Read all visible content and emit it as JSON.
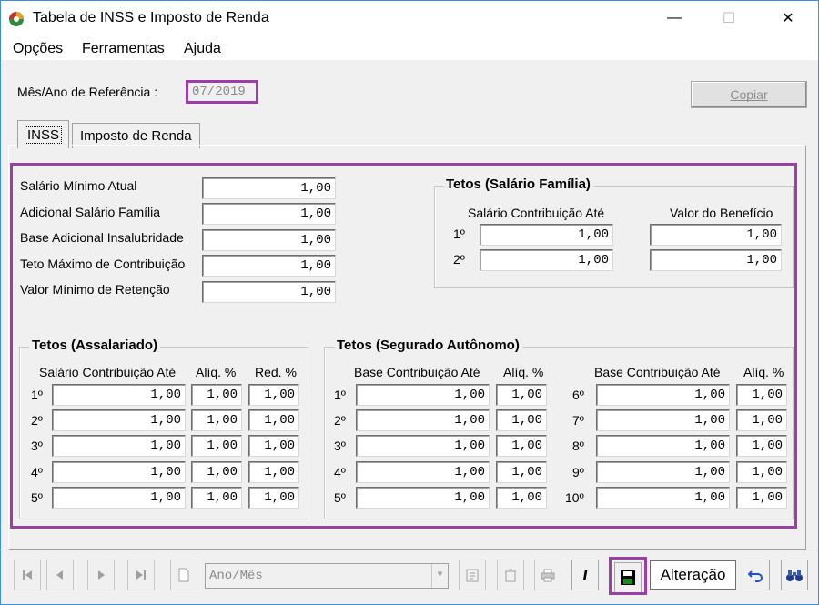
{
  "window": {
    "title": "Tabela de INSS e Imposto de Renda",
    "minimize": "—",
    "maximize": "☐",
    "close": "✕"
  },
  "menu": [
    "Opções",
    "Ferramentas",
    "Ajuda"
  ],
  "reference": {
    "label": "Mês/Ano de Referência :",
    "value": "07/2019"
  },
  "copy_button": "Copiar",
  "tabs": [
    "INSS",
    "Imposto de Renda"
  ],
  "general": [
    {
      "label": "Salário Mínimo Atual",
      "value": "1,00"
    },
    {
      "label": "Adicional Salário Família",
      "value": "1,00"
    },
    {
      "label": "Base Adicional Insalubridade",
      "value": "1,00"
    },
    {
      "label": "Teto Máximo de Contribuição",
      "value": "1,00"
    },
    {
      "label": "Valor Mínimo de Retenção",
      "value": "1,00"
    }
  ],
  "salario_familia": {
    "title": "Tetos (Salário Família)",
    "col_contrib": "Salário Contribuição Até",
    "col_benefit": "Valor do Benefício",
    "rows": [
      {
        "label": "1º",
        "contrib": "1,00",
        "benefit": "1,00"
      },
      {
        "label": "2º",
        "contrib": "1,00",
        "benefit": "1,00"
      }
    ]
  },
  "assalariado": {
    "title": "Tetos (Assalariado)",
    "col_contrib": "Salário Contribuição Até",
    "col_aliq": "Alíq. %",
    "col_red": "Red. %",
    "rows": [
      {
        "label": "1º",
        "contrib": "1,00",
        "aliq": "1,00",
        "red": "1,00"
      },
      {
        "label": "2º",
        "contrib": "1,00",
        "aliq": "1,00",
        "red": "1,00"
      },
      {
        "label": "3º",
        "contrib": "1,00",
        "aliq": "1,00",
        "red": "1,00"
      },
      {
        "label": "4º",
        "contrib": "1,00",
        "aliq": "1,00",
        "red": "1,00"
      },
      {
        "label": "5º",
        "contrib": "1,00",
        "aliq": "1,00",
        "red": "1,00"
      }
    ]
  },
  "autonomo": {
    "title": "Tetos (Segurado Autônomo)",
    "col_base": "Base Contribuição Até",
    "col_aliq": "Alíq. %",
    "rows_left": [
      {
        "label": "1º",
        "base": "1,00",
        "aliq": "1,00"
      },
      {
        "label": "2º",
        "base": "1,00",
        "aliq": "1,00"
      },
      {
        "label": "3º",
        "base": "1,00",
        "aliq": "1,00"
      },
      {
        "label": "4º",
        "base": "1,00",
        "aliq": "1,00"
      },
      {
        "label": "5º",
        "base": "1,00",
        "aliq": "1,00"
      }
    ],
    "rows_right": [
      {
        "label": "6º",
        "base": "1,00",
        "aliq": "1,00"
      },
      {
        "label": "7º",
        "base": "1,00",
        "aliq": "1,00"
      },
      {
        "label": "8º",
        "base": "1,00",
        "aliq": "1,00"
      },
      {
        "label": "9º",
        "base": "1,00",
        "aliq": "1,00"
      },
      {
        "label": "10º",
        "base": "1,00",
        "aliq": "1,00"
      }
    ]
  },
  "toolbar": {
    "combo_placeholder": "Ano/Mês",
    "mode": "Alteração",
    "italic_label": "I"
  },
  "colors": {
    "highlight": "#9b3ea8"
  }
}
